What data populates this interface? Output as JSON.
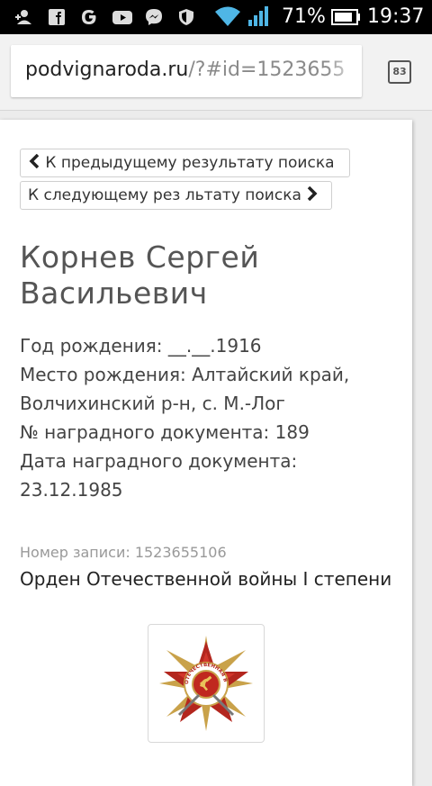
{
  "status_bar": {
    "battery": "71%",
    "time": "19:37",
    "icons": [
      "accounts-icon",
      "facebook-icon",
      "google-icon",
      "youtube-icon",
      "messenger-icon",
      "shield-icon",
      "wifi-icon",
      "signal-icon",
      "battery-icon"
    ]
  },
  "browser": {
    "url_domain": "podvignaroda.ru",
    "url_path": "/?#id=1523655",
    "tab_count": "83"
  },
  "page": {
    "prev_button": "К предыдущему результату поиска",
    "next_button": "К следующему рез льтату поиска",
    "name": "Корнев Сергей Васильевич",
    "details": [
      "Год рождения: __.__.1916",
      "Место рождения: Алтайский край, Волчихинский р-н, с. М.-Лог",
      "№ наградного документа: 189",
      "Дата наградного документа: 23.12.1985"
    ],
    "record_number": "Номер записи: 1523655106",
    "award_name": "Орден Отечественной войны I степени",
    "medal_inscription": "ОТЕЧЕСТВЕННАЯ ВОЙНА"
  }
}
